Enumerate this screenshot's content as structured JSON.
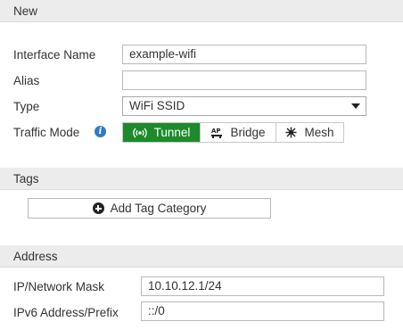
{
  "sections": {
    "new": "New",
    "tags": "Tags",
    "address": "Address"
  },
  "fields": {
    "interface_name": {
      "label": "Interface Name",
      "value": "example-wifi"
    },
    "alias": {
      "label": "Alias",
      "value": ""
    },
    "type": {
      "label": "Type",
      "value": "WiFi SSID"
    },
    "traffic_mode": {
      "label": "Traffic Mode",
      "info_icon": "info-icon",
      "options": [
        {
          "label": "Tunnel",
          "icon": "wifi-broadcast-icon",
          "selected": true
        },
        {
          "label": "Bridge",
          "icon": "access-point-bridge-icon",
          "selected": false
        },
        {
          "label": "Mesh",
          "icon": "mesh-icon",
          "selected": false
        }
      ]
    },
    "ip_mask": {
      "label": "IP/Network Mask",
      "value": "10.10.12.1/24"
    },
    "ipv6": {
      "label": "IPv6 Address/Prefix",
      "value": "::/0"
    }
  },
  "tags": {
    "add_button": "Add Tag Category",
    "add_icon": "plus-circle-icon"
  },
  "colors": {
    "active_segment": "#1d8a2b",
    "info_icon": "#2f79c6",
    "section_bg": "#ececec"
  }
}
